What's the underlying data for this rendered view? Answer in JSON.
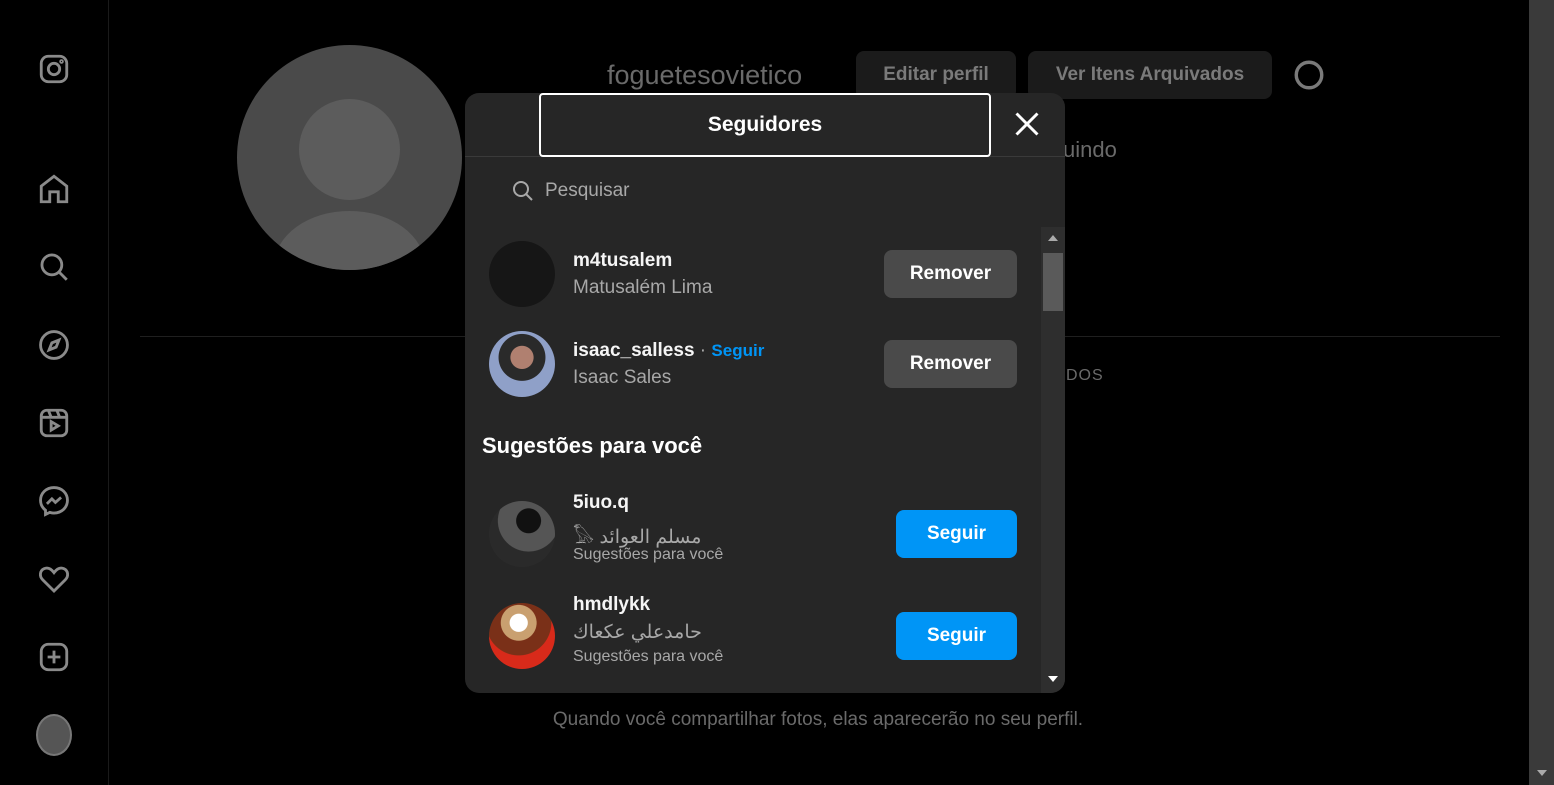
{
  "profile": {
    "username": "foguetesovietico",
    "edit_label": "Editar perfil",
    "archive_label": "Ver Itens Arquivados",
    "following_partial": "uindo",
    "tab_partial": "DOS",
    "empty_text": "Quando você compartilhar fotos, elas aparecerão no seu perfil."
  },
  "modal": {
    "title": "Seguidores",
    "search_placeholder": "Pesquisar",
    "followers": [
      {
        "username": "m4tusalem",
        "name": "Matusalém Lima",
        "button": "Remover"
      },
      {
        "username": "isaac_salless",
        "follow_link": "Seguir",
        "separator": "·",
        "name": "Isaac Sales",
        "button": "Remover"
      }
    ],
    "suggestions_title": "Sugestões para você",
    "suggestions": [
      {
        "username": "5iuo.q",
        "name": "مسلم العوائد 𓅃",
        "subtitle": "Sugestões para você",
        "button": "Seguir"
      },
      {
        "username": "hmdlykk",
        "name": "حامدعلي عكعاك",
        "subtitle": "Sugestões para você",
        "button": "Seguir"
      }
    ]
  },
  "colors": {
    "accent": "#0095f6",
    "modal_bg": "#262626"
  }
}
